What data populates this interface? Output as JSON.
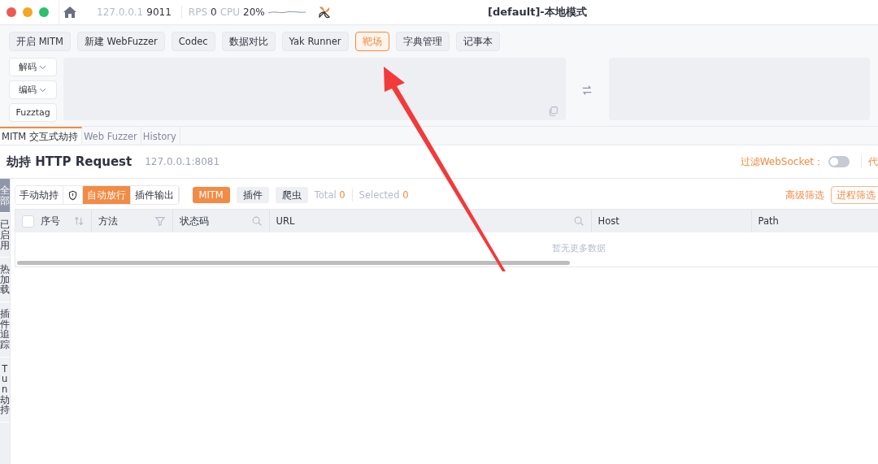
{
  "titlebar": {
    "host": "127.0.0.1",
    "port": "9011",
    "rps_label": "RPS",
    "rps": "0",
    "cpu_label": "CPU",
    "cpu": "20%",
    "title": "[default]-本地模式"
  },
  "toolbar": [
    {
      "label": "开启 MITM",
      "selected": false
    },
    {
      "label": "新建 WebFuzzer",
      "selected": false
    },
    {
      "label": "Codec",
      "selected": false
    },
    {
      "label": "数据对比",
      "selected": false
    },
    {
      "label": "Yak Runner",
      "selected": false
    },
    {
      "label": "靶场",
      "selected": true
    },
    {
      "label": "字典管理",
      "selected": false
    },
    {
      "label": "记事本",
      "selected": false
    }
  ],
  "codec_buttons": [
    {
      "label": "解码",
      "kind": "dropdown"
    },
    {
      "label": "编码",
      "kind": "dropdown"
    },
    {
      "label": "Fuzztag",
      "kind": "plain"
    }
  ],
  "tabs": [
    {
      "label": "MITM 交互式劫持",
      "selected": true
    },
    {
      "label": "Web Fuzzer",
      "selected": false
    },
    {
      "label": "History",
      "selected": false
    }
  ],
  "header": {
    "title": "劫持 HTTP Request",
    "address": "127.0.0.1:8081",
    "filter_label": "过滤WebSocket：",
    "filter_on": false,
    "proxy_label": "代"
  },
  "side_tabs": [
    {
      "label": "全部",
      "selected": true
    },
    {
      "label": "已启用",
      "selected": false
    },
    {
      "label": "热加载",
      "selected": false
    },
    {
      "label": "插件追踪",
      "selected": false
    },
    {
      "label": "Tun劫持",
      "selected": false
    }
  ],
  "modes": [
    {
      "kind": "text",
      "label": "手动劫持",
      "selected": false
    },
    {
      "kind": "icon",
      "selected": false
    },
    {
      "kind": "text",
      "label": "自动放行",
      "selected": true
    },
    {
      "kind": "text",
      "label": "插件输出",
      "selected": false
    }
  ],
  "sources": [
    {
      "label": "MITM",
      "selected": true
    },
    {
      "label": "插件",
      "selected": false
    },
    {
      "label": "爬虫",
      "selected": false
    }
  ],
  "counts": {
    "total_label": "Total",
    "total": "0",
    "selected_label": "Selected",
    "selected": "0"
  },
  "advanced_filter": "高级筛选",
  "process_filter": "进程筛选",
  "table": {
    "select_all_checked": false,
    "columns": [
      {
        "label": "序号",
        "kind": "sort"
      },
      {
        "label": "方法",
        "kind": "filter"
      },
      {
        "label": "状态码",
        "kind": "search"
      },
      {
        "label": "URL",
        "kind": "search"
      },
      {
        "label": "Host",
        "kind": "plain"
      },
      {
        "label": "Path",
        "kind": "plain"
      }
    ],
    "empty": "暂无更多数据"
  }
}
